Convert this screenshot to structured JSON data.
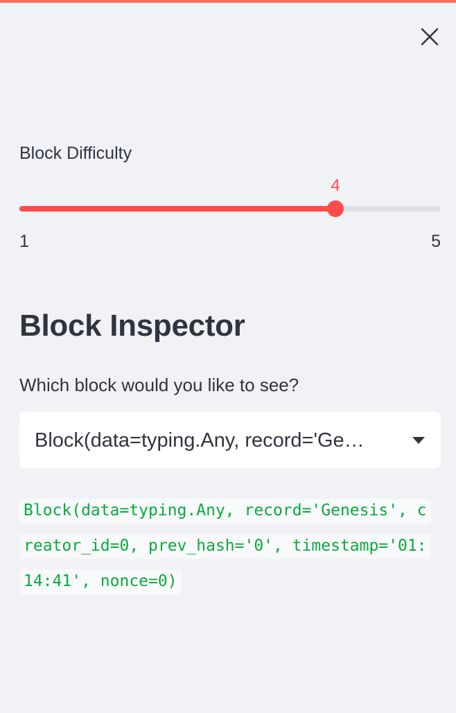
{
  "header": {
    "close_icon": "close-icon"
  },
  "slider": {
    "label": "Block Difficulty",
    "value": "4",
    "min": "1",
    "max": "5",
    "fill_fraction": 0.75,
    "accent_color": "#ff4b4b"
  },
  "inspector": {
    "title": "Block Inspector",
    "question": "Which block would you like to see?",
    "select": {
      "value": "Block(data=typing.Any, record='Ge…",
      "arrow_icon": "chevron-down-icon"
    },
    "code_text": "Block(data=typing.Any, record='Genesis', creator_id=0, prev_hash='0', timestamp='01:14:41', nonce=0)",
    "code_color": "#09ab3b"
  },
  "theme": {
    "top_accent_color": "#ff6c5c",
    "background": "#f0f2f6"
  }
}
